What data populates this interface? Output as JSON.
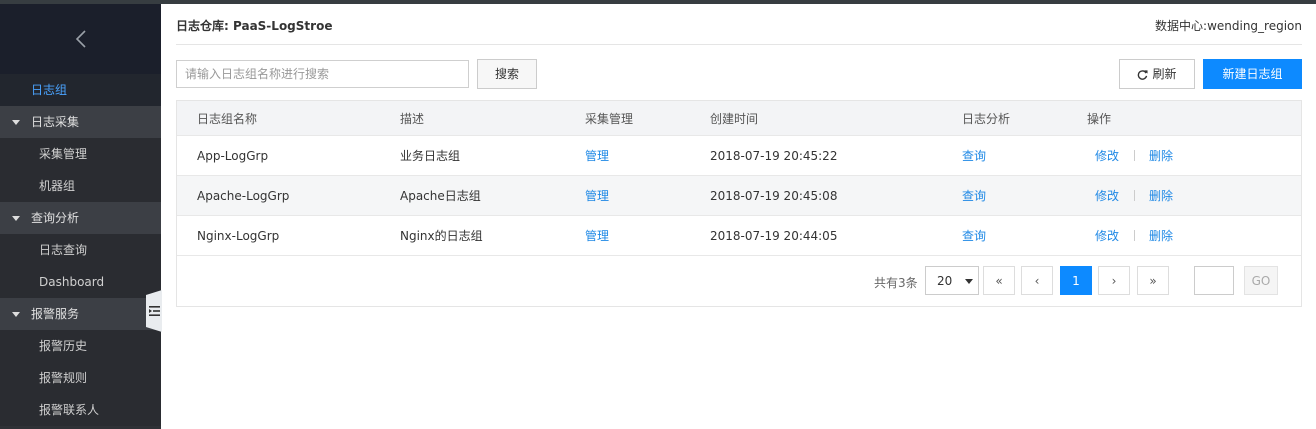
{
  "sidebar": {
    "items": [
      {
        "type": "active",
        "label": "日志组"
      },
      {
        "type": "group",
        "label": "日志采集"
      },
      {
        "type": "sub",
        "label": "采集管理"
      },
      {
        "type": "sub",
        "label": "机器组"
      },
      {
        "type": "group",
        "label": "查询分析"
      },
      {
        "type": "sub",
        "label": "日志查询"
      },
      {
        "type": "sub",
        "label": "Dashboard"
      },
      {
        "type": "group",
        "label": "报警服务"
      },
      {
        "type": "sub",
        "label": "报警历史"
      },
      {
        "type": "sub",
        "label": "报警规则"
      },
      {
        "type": "sub",
        "label": "报警联系人"
      }
    ]
  },
  "header": {
    "repo_label": "日志仓库:",
    "repo_name": "PaaS-LogStroe",
    "region_label": "数据中心:",
    "region_name": "wending_region"
  },
  "toolbar": {
    "search_placeholder": "请输入日志组名称进行搜索",
    "search_label": "搜索",
    "refresh_label": "刷新",
    "new_label": "新建日志组"
  },
  "table": {
    "headers": [
      "日志组名称",
      "描述",
      "采集管理",
      "创建时间",
      "日志分析",
      "操作"
    ],
    "rows": [
      {
        "name": "App-LogGrp",
        "desc": "业务日志组",
        "manage": "管理",
        "created": "2018-07-19 20:45:22",
        "query": "查询",
        "edit": "修改",
        "delete": "删除"
      },
      {
        "name": "Apache-LogGrp",
        "desc": "Apache日志组",
        "manage": "管理",
        "created": "2018-07-19 20:45:08",
        "query": "查询",
        "edit": "修改",
        "delete": "删除"
      },
      {
        "name": "Nginx-LogGrp",
        "desc": "Nginx的日志组",
        "manage": "管理",
        "created": "2018-07-19 20:44:05",
        "query": "查询",
        "edit": "修改",
        "delete": "删除"
      }
    ]
  },
  "pager": {
    "total": "共有3条",
    "page_size": "20",
    "first": "«",
    "prev": "‹",
    "current": "1",
    "next": "›",
    "last": "»",
    "go": "GO"
  }
}
